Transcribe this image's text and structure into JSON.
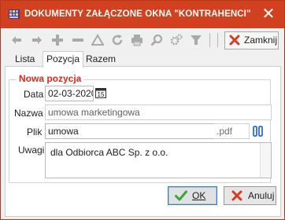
{
  "window": {
    "title": "DOKUMENTY ZAŁĄCZONE OKNA \"KONTRAHENCI\"",
    "close_glyph": "✕"
  },
  "toolbar": {
    "icons": [
      "arrow-left-icon",
      "arrow-right-icon",
      "plus-icon",
      "minus-icon",
      "triangle-icon",
      "refresh-icon",
      "printer-icon",
      "zoom-icon",
      "gear-icon",
      "filter-icon"
    ],
    "close_label": "Zamknij"
  },
  "tabs": [
    {
      "label": "Lista"
    },
    {
      "label": "Pozycja",
      "active": true
    },
    {
      "label": "Razem"
    }
  ],
  "form": {
    "group_title": "Nowa pozycja",
    "date_label": "Data",
    "date_value": "02-03-2020",
    "name_label": "Nazwa",
    "name_value": "umowa marketingowa",
    "file_label": "Plik",
    "file_value": "umowa",
    "file_ext": ".pdf",
    "notes_label": "Uwagi",
    "notes_value": "dla Odbiorca ABC Sp. z o.o."
  },
  "buttons": {
    "ok_label": "OK",
    "cancel_label": "Anuluj"
  },
  "colors": {
    "titlebar": "#d2411f",
    "group_title": "#e3261b"
  }
}
